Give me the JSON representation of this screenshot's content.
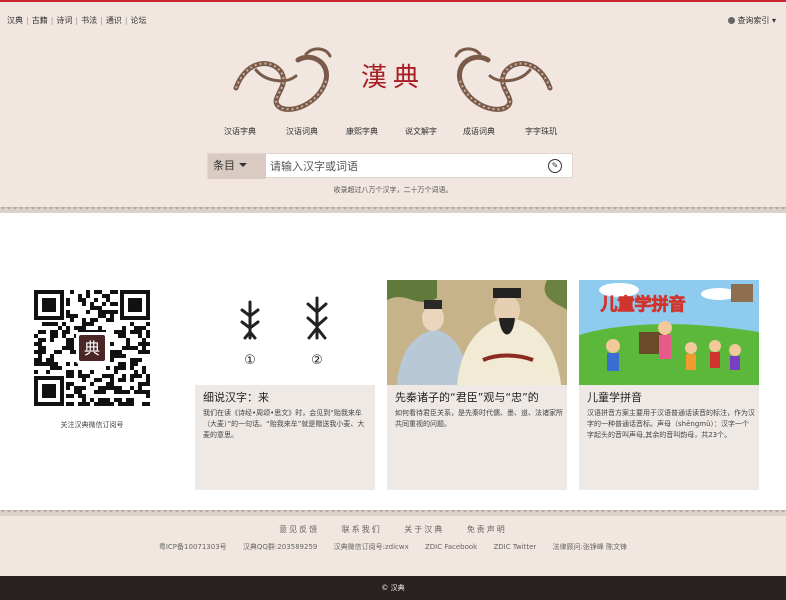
{
  "topnav": {
    "items": [
      "汉典",
      "古籍",
      "诗词",
      "书法",
      "通识",
      "论坛"
    ]
  },
  "lookup_label": "查询索引",
  "logo_text": "漢典",
  "mainnav": [
    "汉语字典",
    "汉语词典",
    "康熙字典",
    "说文解字",
    "成语词典",
    "字字珠玑"
  ],
  "search": {
    "scope": "条目",
    "placeholder": "请输入汉字或词语",
    "handwrite_icon": "handwriting-icon"
  },
  "note": "收录超过八万个汉字，二十万个词语。",
  "qr_caption": "关注汉典微信订阅号",
  "qr_center": "典",
  "cards": [
    {
      "title": "细说汉字：来",
      "desc": "我们在读《诗经•周颂•思文》时，会见到“贻我来牟（大麦）”的一句话。“贻我来牟”就是赠送我小麦、大麦的意思。",
      "num1": "①",
      "num2": "②"
    },
    {
      "title": "先秦诸子的“君臣”观与“忠”的",
      "desc": "如何看待君臣关系，是先秦时代儒、墨、道、法诸家所共同重视的问题。"
    },
    {
      "title": "儿童学拼音",
      "desc": "汉语拼音方案主要用于汉语普通话读音的标注，作为汉字的一种普通话音标。声母（shēngmǔ）：汉字一个字起头的音叫声母,其余的音叫韵母，共23个。",
      "banner": "儿童学拼音"
    }
  ],
  "footer": {
    "links": [
      "意见反馈",
      "联系我们",
      "关于汉典",
      "免责声明"
    ],
    "info": [
      "粤ICP备10071303号",
      "汉典QQ群:203589259",
      "汉典微信订阅号:zdicwx",
      "ZDIC Facebook",
      "ZDIC Twitter",
      "法律顾问:张铮峰 陈文锋"
    ],
    "copyright": "© 汉典"
  },
  "colors": {
    "header_bg": "#f1e6e0",
    "accent": "#c9252c",
    "logo_red": "#a81e24",
    "bottom_bar": "#2a2222"
  }
}
